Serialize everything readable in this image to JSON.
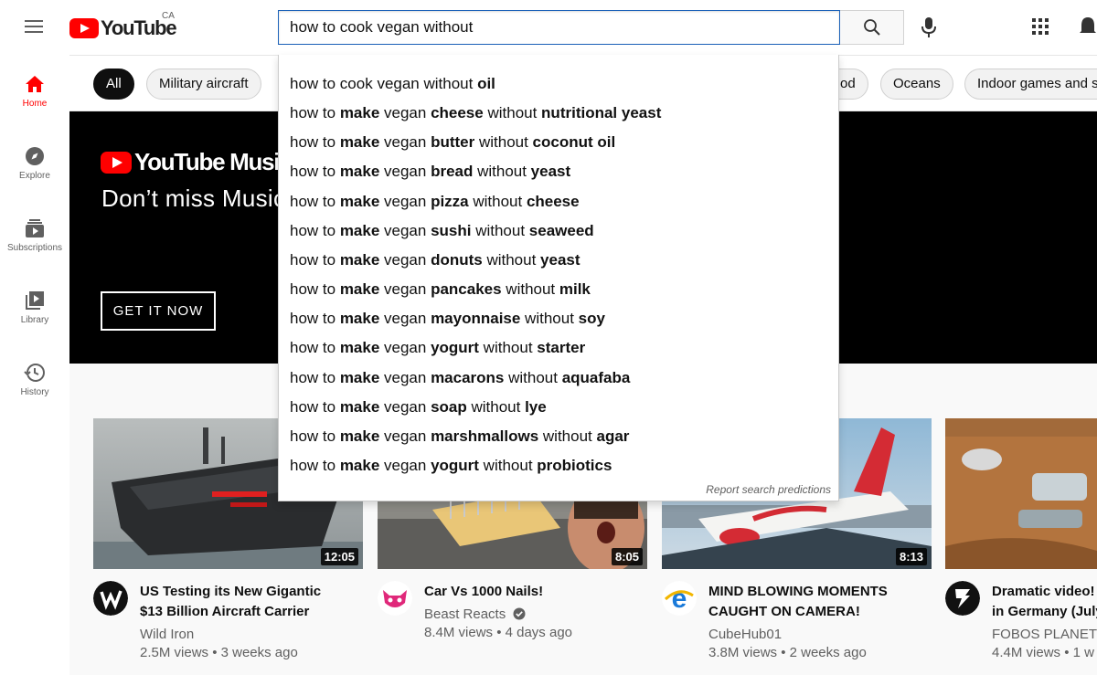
{
  "header": {
    "logo_text": "YouTube",
    "country": "CA",
    "search_value": "how to cook vegan without"
  },
  "sidebar": {
    "items": [
      {
        "label": "Home",
        "icon": "home-icon"
      },
      {
        "label": "Explore",
        "icon": "compass-icon"
      },
      {
        "label": "Subscriptions",
        "icon": "subscriptions-icon"
      },
      {
        "label": "Library",
        "icon": "library-icon"
      },
      {
        "label": "History",
        "icon": "history-icon"
      }
    ]
  },
  "chips": [
    "All",
    "Military aircraft",
    "od",
    "Oceans",
    "Indoor games and s"
  ],
  "banner": {
    "logo_text": "YouTube Music",
    "tagline": "Don’t miss Music",
    "button": "GET IT NOW"
  },
  "suggestions": [
    [
      [
        "how to cook vegan without ",
        false
      ],
      [
        "oil",
        true
      ]
    ],
    [
      [
        "how to ",
        false
      ],
      [
        "make",
        true
      ],
      [
        " vegan ",
        false
      ],
      [
        "cheese",
        true
      ],
      [
        " without ",
        false
      ],
      [
        "nutritional yeast",
        true
      ]
    ],
    [
      [
        "how to ",
        false
      ],
      [
        "make",
        true
      ],
      [
        " vegan ",
        false
      ],
      [
        "butter",
        true
      ],
      [
        " without ",
        false
      ],
      [
        "coconut oil",
        true
      ]
    ],
    [
      [
        "how to ",
        false
      ],
      [
        "make",
        true
      ],
      [
        " vegan ",
        false
      ],
      [
        "bread",
        true
      ],
      [
        " without ",
        false
      ],
      [
        "yeast",
        true
      ]
    ],
    [
      [
        "how to ",
        false
      ],
      [
        "make",
        true
      ],
      [
        " vegan ",
        false
      ],
      [
        "pizza",
        true
      ],
      [
        " without ",
        false
      ],
      [
        "cheese",
        true
      ]
    ],
    [
      [
        "how to ",
        false
      ],
      [
        "make",
        true
      ],
      [
        " vegan ",
        false
      ],
      [
        "sushi",
        true
      ],
      [
        " without ",
        false
      ],
      [
        "seaweed",
        true
      ]
    ],
    [
      [
        "how to ",
        false
      ],
      [
        "make",
        true
      ],
      [
        " vegan ",
        false
      ],
      [
        "donuts",
        true
      ],
      [
        " without ",
        false
      ],
      [
        "yeast",
        true
      ]
    ],
    [
      [
        "how to ",
        false
      ],
      [
        "make",
        true
      ],
      [
        " vegan ",
        false
      ],
      [
        "pancakes",
        true
      ],
      [
        " without ",
        false
      ],
      [
        "milk",
        true
      ]
    ],
    [
      [
        "how to ",
        false
      ],
      [
        "make",
        true
      ],
      [
        " vegan ",
        false
      ],
      [
        "mayonnaise",
        true
      ],
      [
        " without ",
        false
      ],
      [
        "soy",
        true
      ]
    ],
    [
      [
        "how to ",
        false
      ],
      [
        "make",
        true
      ],
      [
        " vegan ",
        false
      ],
      [
        "yogurt",
        true
      ],
      [
        " without ",
        false
      ],
      [
        "starter",
        true
      ]
    ],
    [
      [
        "how to ",
        false
      ],
      [
        "make",
        true
      ],
      [
        " vegan ",
        false
      ],
      [
        "macarons",
        true
      ],
      [
        " without ",
        false
      ],
      [
        "aquafaba",
        true
      ]
    ],
    [
      [
        "how to ",
        false
      ],
      [
        "make",
        true
      ],
      [
        " vegan ",
        false
      ],
      [
        "soap",
        true
      ],
      [
        " without ",
        false
      ],
      [
        "lye",
        true
      ]
    ],
    [
      [
        "how to ",
        false
      ],
      [
        "make",
        true
      ],
      [
        " vegan ",
        false
      ],
      [
        "marshmallows",
        true
      ],
      [
        " without ",
        false
      ],
      [
        "agar",
        true
      ]
    ],
    [
      [
        "how to ",
        false
      ],
      [
        "make",
        true
      ],
      [
        " vegan ",
        false
      ],
      [
        "yogurt",
        true
      ],
      [
        " without ",
        false
      ],
      [
        "probiotics",
        true
      ]
    ]
  ],
  "report_text": "Report search predictions",
  "videos": [
    {
      "title_line1": "US Testing its New Gigantic",
      "title_line2": "$13 Billion Aircraft Carrier",
      "channel": "Wild Iron",
      "meta": "2.5M views • 3 weeks ago",
      "duration": "12:05"
    },
    {
      "title_line1": "Car Vs 1000 Nails!",
      "title_line2": "",
      "channel": "Beast Reacts",
      "meta": "8.4M views • 4 days ago",
      "duration": "8:05"
    },
    {
      "title_line1": "MIND BLOWING MOMENTS",
      "title_line2": "CAUGHT ON CAMERA!",
      "channel": "CubeHub01",
      "meta": "3.8M views • 2 weeks ago",
      "duration": "8:13"
    },
    {
      "title_line1": "Dramatic video! (",
      "title_line2": "in Germany (July",
      "channel": "FOBOS PLANET",
      "meta": "4.4M views • 1 w",
      "duration": ""
    }
  ],
  "colors": {
    "brand_red": "#ff0000",
    "search_border": "#1c62b9"
  }
}
